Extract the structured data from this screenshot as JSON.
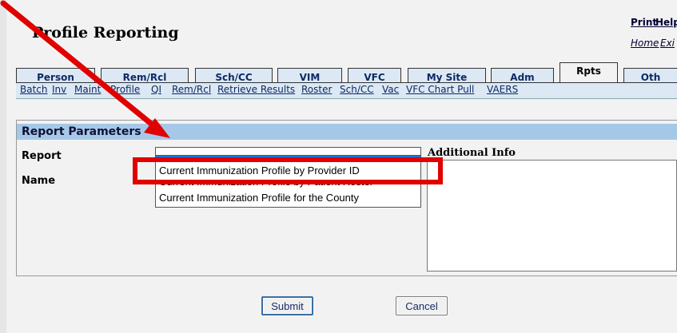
{
  "page": {
    "title": "Profile Reporting"
  },
  "top_links": {
    "print": "Print",
    "help": "Help",
    "home": "Home",
    "exit": "Exi"
  },
  "tabs": [
    {
      "label": "Person",
      "active": false
    },
    {
      "label": "Rem/Rcl",
      "active": false
    },
    {
      "label": "Sch/CC",
      "active": false
    },
    {
      "label": "VIM",
      "active": false
    },
    {
      "label": "VFC",
      "active": false
    },
    {
      "label": "My Site",
      "active": false
    },
    {
      "label": "Adm",
      "active": false
    },
    {
      "label": "Rpts",
      "active": true
    },
    {
      "label": "Oth",
      "active": false
    }
  ],
  "subnav": [
    "Batch",
    "Inv",
    "Maint",
    "Profile",
    "QI",
    "Rem/Rcl",
    "Retrieve Results",
    "Roster",
    "Sch/CC",
    "Vac",
    "VFC Chart Pull",
    "VAERS"
  ],
  "report_parameters": {
    "header": "Report Parameters",
    "report_label": "Report",
    "name_label": "Name",
    "additional_info_label": "Additional Info",
    "report_options": [
      "Current Immunization Profile by Provider ID",
      "Current Immunization Profile by Patient Roster",
      "Current Immunization Profile for the County"
    ]
  },
  "buttons": {
    "submit": "Submit",
    "cancel": "Cancel"
  },
  "colors": {
    "annotation_red": "#e00000",
    "header_blue": "#a6c8e8",
    "tab_blue": "#dce8f4",
    "selection_blue": "#1e74d9"
  }
}
